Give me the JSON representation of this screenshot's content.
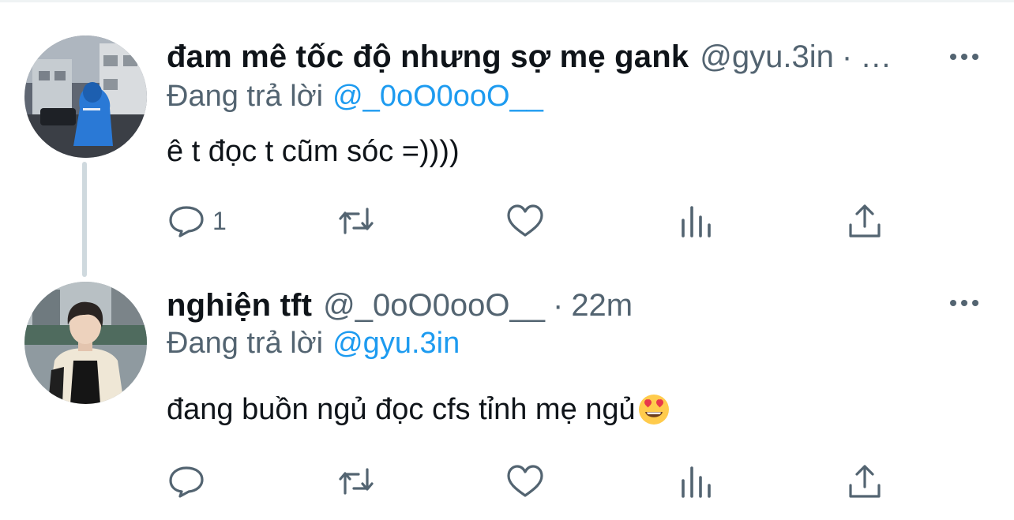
{
  "colors": {
    "text_primary": "#0f1419",
    "text_secondary": "#536471",
    "link": "#1d9bf0",
    "thread_line": "#cfd9de"
  },
  "tweets": [
    {
      "display_name": "đam mê tốc độ nhưng sợ mẹ gank",
      "handle": "@gyu.3in",
      "separator": "·",
      "time": "…",
      "replying_prefix": "Đang trả lời",
      "replying_to": "@_0oO0ooO__",
      "text": "ê t đọc t cũm sóc =))))",
      "emoji": "",
      "reply_count": "1",
      "icons": [
        "reply-icon",
        "retweet-icon",
        "like-icon",
        "views-icon",
        "share-icon",
        "more-icon"
      ]
    },
    {
      "display_name": "nghiện tft",
      "handle": "@_0oO0ooO__",
      "separator": "·",
      "time": "22m",
      "replying_prefix": "Đang trả lời",
      "replying_to": "@gyu.3in",
      "text": "đang buồn ngủ đọc cfs tỉnh mẹ ngủ",
      "emoji": "heart-eyes-emoji",
      "reply_count": "",
      "icons": [
        "reply-icon",
        "retweet-icon",
        "like-icon",
        "views-icon",
        "share-icon",
        "more-icon"
      ]
    }
  ]
}
